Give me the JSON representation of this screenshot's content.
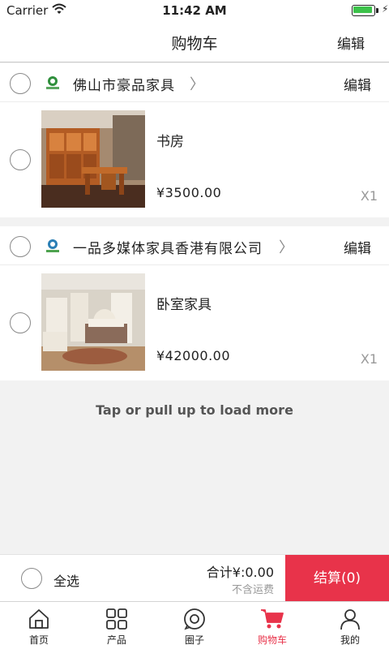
{
  "status_bar": {
    "carrier": "Carrier",
    "time": "11:42 AM"
  },
  "header": {
    "title": "购物车",
    "edit_label": "编辑"
  },
  "stores": [
    {
      "name": "佛山市豪品家具",
      "edit_label": "编辑",
      "items": [
        {
          "name": "书房",
          "price": "¥3500.00",
          "qty": "X1"
        }
      ]
    },
    {
      "name": "一品多媒体家具香港有限公司",
      "edit_label": "编辑",
      "items": [
        {
          "name": "卧室家具",
          "price": "¥42000.00",
          "qty": "X1"
        }
      ]
    }
  ],
  "load_more": "Tap or pull up to load more",
  "checkout": {
    "select_all": "全选",
    "total": "合计¥:0.00",
    "shipping_note": "不含运费",
    "pay_button": "结算(0)"
  },
  "tabs": [
    {
      "label": "首页",
      "icon": "home-icon"
    },
    {
      "label": "产品",
      "icon": "grid-icon"
    },
    {
      "label": "圈子",
      "icon": "circle-icon"
    },
    {
      "label": "购物车",
      "icon": "cart-icon",
      "active": true
    },
    {
      "label": "我的",
      "icon": "user-icon"
    }
  ],
  "colors": {
    "accent": "#e8334a",
    "battery": "#3cc24a",
    "background": "#f2f2f2"
  }
}
